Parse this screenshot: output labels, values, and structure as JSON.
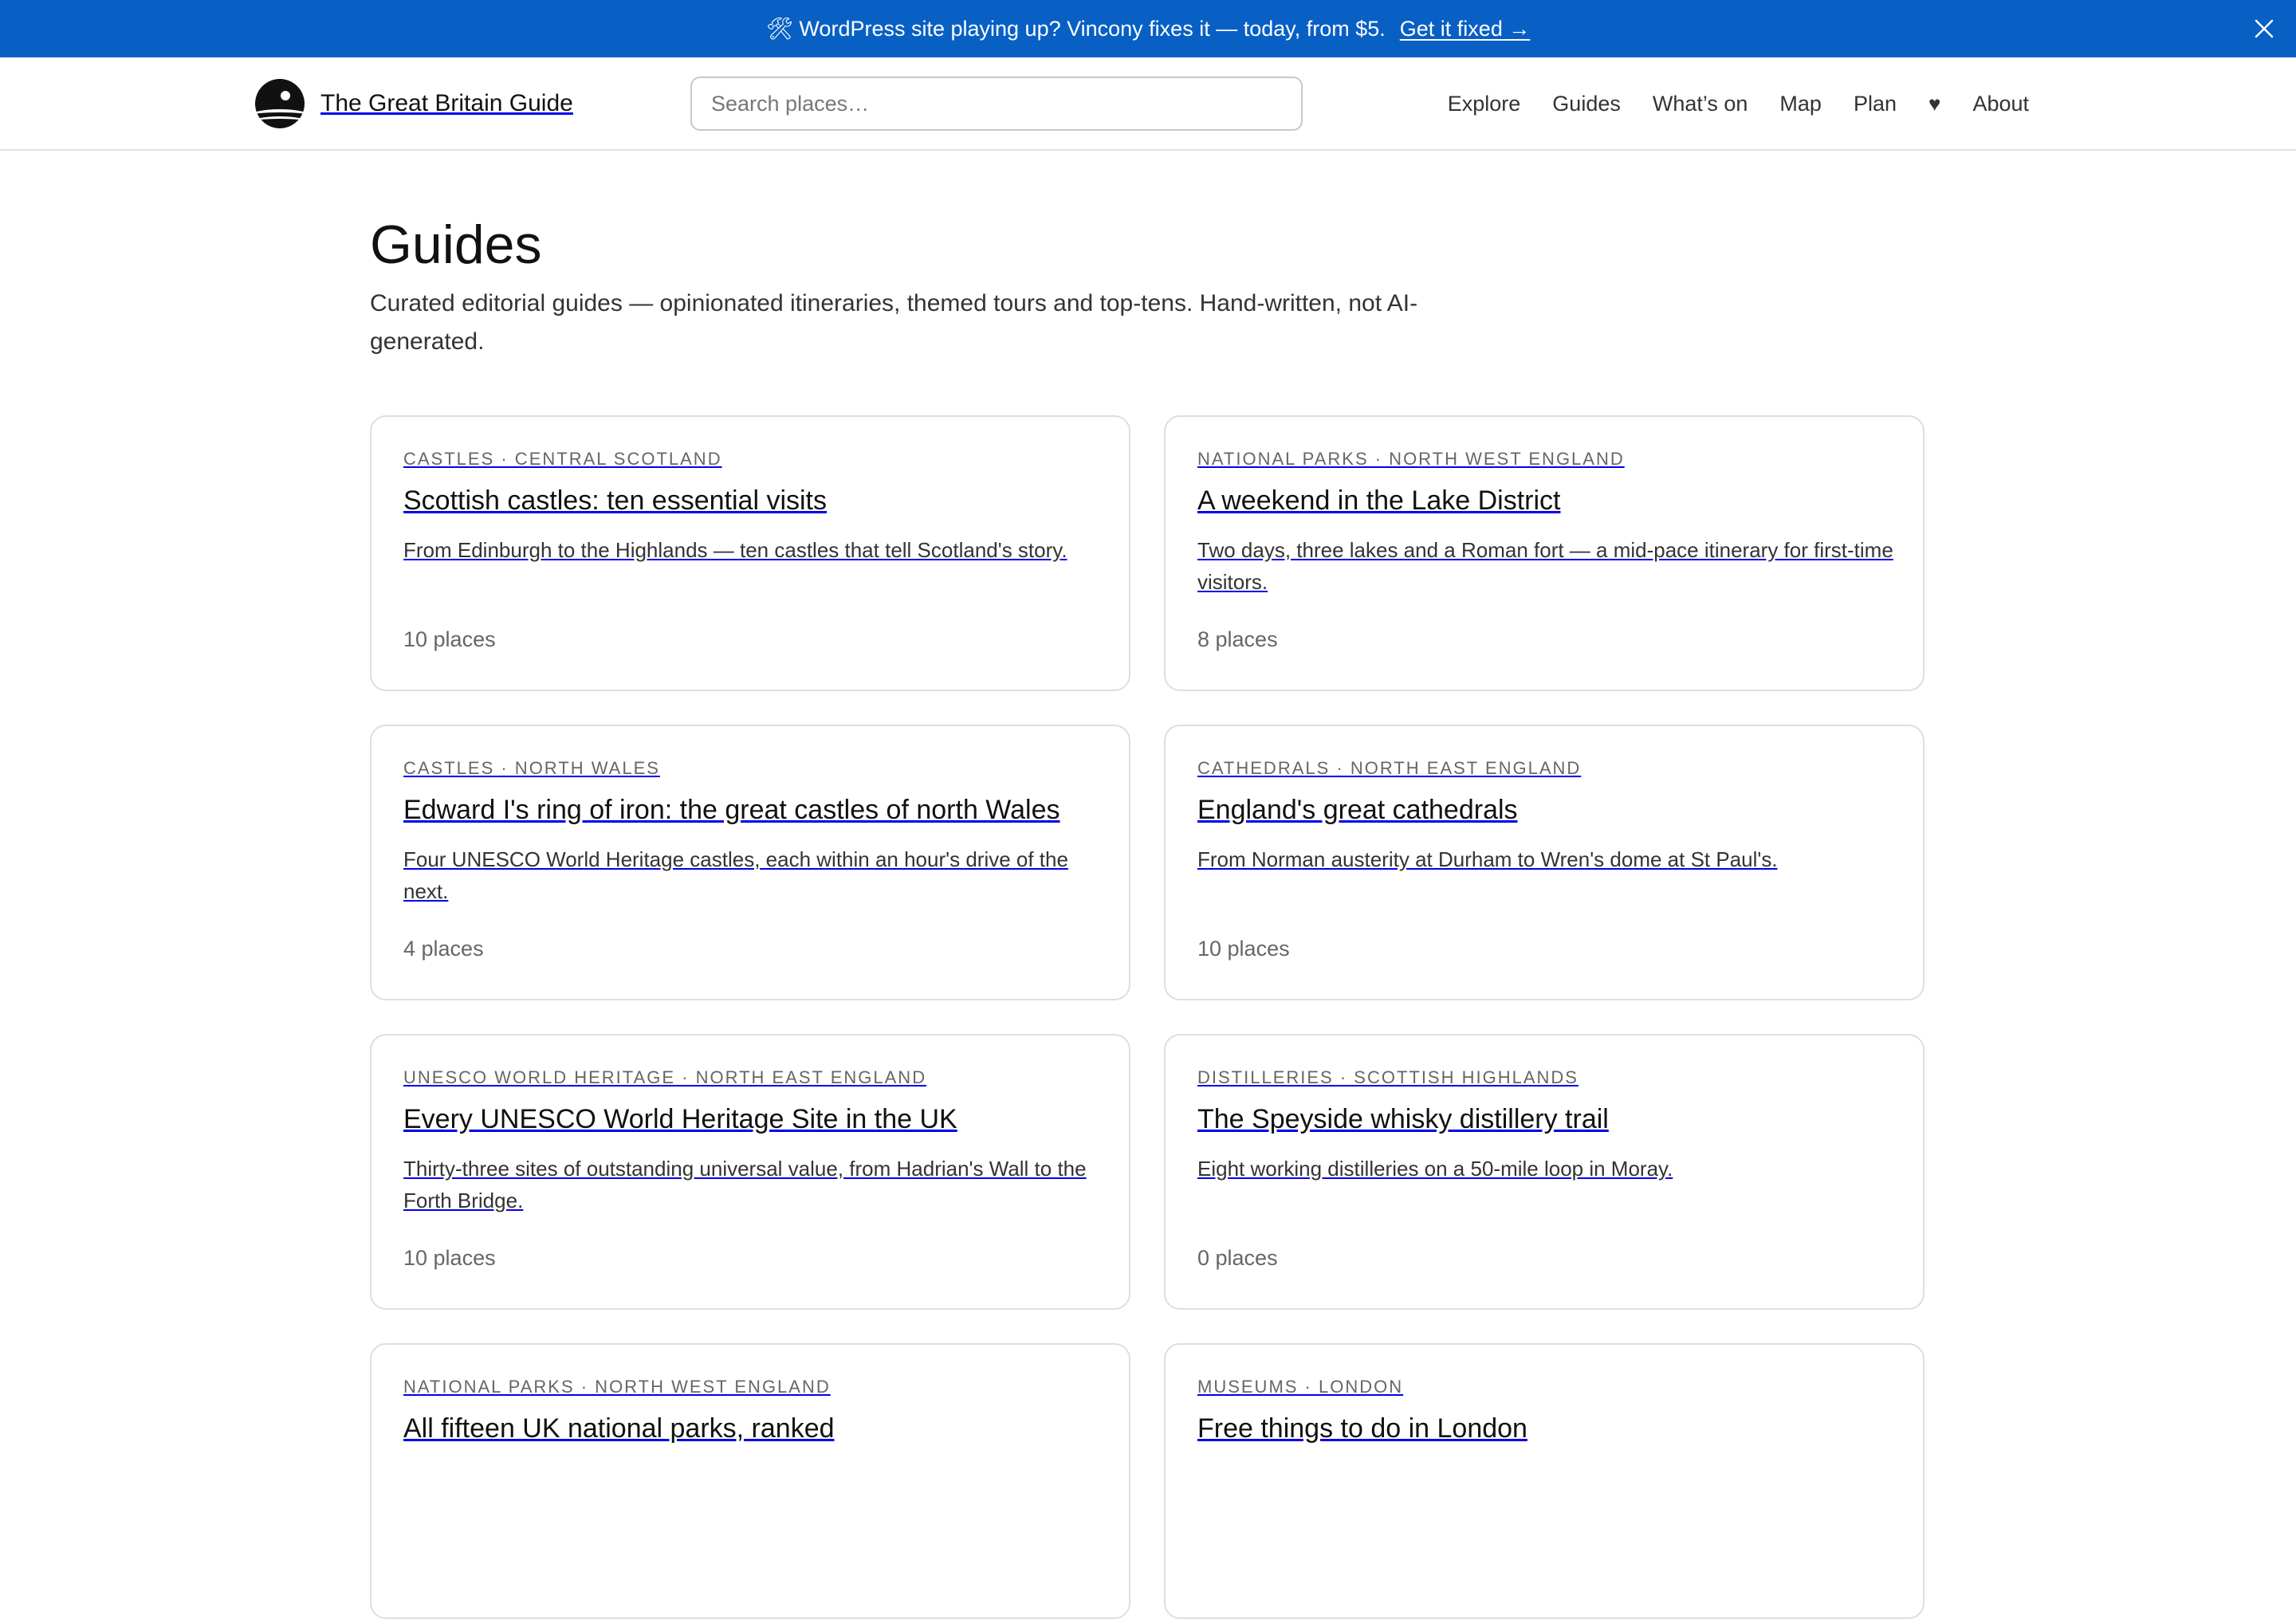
{
  "banner": {
    "text": "🛠 WordPress site playing up? Vincony fixes it — today, from $5.",
    "link": "Get it fixed →",
    "close_icon": "close-icon"
  },
  "header": {
    "site_name": "The Great Britain Guide",
    "logo_icon": "logo-icon",
    "search_placeholder": "Search places…",
    "nav": {
      "explore": "Explore",
      "guides": "Guides",
      "whats_on": "What’s on",
      "map": "Map",
      "plan": "Plan",
      "favourites": "♥",
      "about": "About"
    }
  },
  "page": {
    "title": "Guides",
    "description": "Curated editorial guides — opinionated itineraries, themed tours and top-tens. Hand-written, not AI-generated."
  },
  "guides": [
    {
      "kicker": "CASTLES · CENTRAL SCOTLAND",
      "title": "Scottish castles: ten essential visits",
      "blurb": "From Edinburgh to the Highlands — ten castles that tell Scotland's story.",
      "count": "10 places"
    },
    {
      "kicker": "NATIONAL PARKS · NORTH WEST ENGLAND",
      "title": "A weekend in the Lake District",
      "blurb": "Two days, three lakes and a Roman fort — a mid-pace itinerary for first-time visitors.",
      "count": "8 places"
    },
    {
      "kicker": "CASTLES · NORTH WALES",
      "title": "Edward I's ring of iron: the great castles of north Wales",
      "blurb": "Four UNESCO World Heritage castles, each within an hour's drive of the next.",
      "count": "4 places"
    },
    {
      "kicker": "CATHEDRALS · NORTH EAST ENGLAND",
      "title": "England's great cathedrals",
      "blurb": "From Norman austerity at Durham to Wren's dome at St Paul's.",
      "count": "10 places"
    },
    {
      "kicker": "UNESCO WORLD HERITAGE · NORTH EAST ENGLAND",
      "title": "Every UNESCO World Heritage Site in the UK",
      "blurb": "Thirty-three sites of outstanding universal value, from Hadrian's Wall to the Forth Bridge.",
      "count": "10 places"
    },
    {
      "kicker": "DISTILLERIES · SCOTTISH HIGHLANDS",
      "title": "The Speyside whisky distillery trail",
      "blurb": "Eight working distilleries on a 50-mile loop in Moray.",
      "count": "0 places"
    },
    {
      "kicker": "NATIONAL PARKS · NORTH WEST ENGLAND",
      "title": "All fifteen UK national parks, ranked",
      "blurb": "",
      "count": ""
    },
    {
      "kicker": "MUSEUMS · LONDON",
      "title": "Free things to do in London",
      "blurb": "",
      "count": ""
    }
  ]
}
